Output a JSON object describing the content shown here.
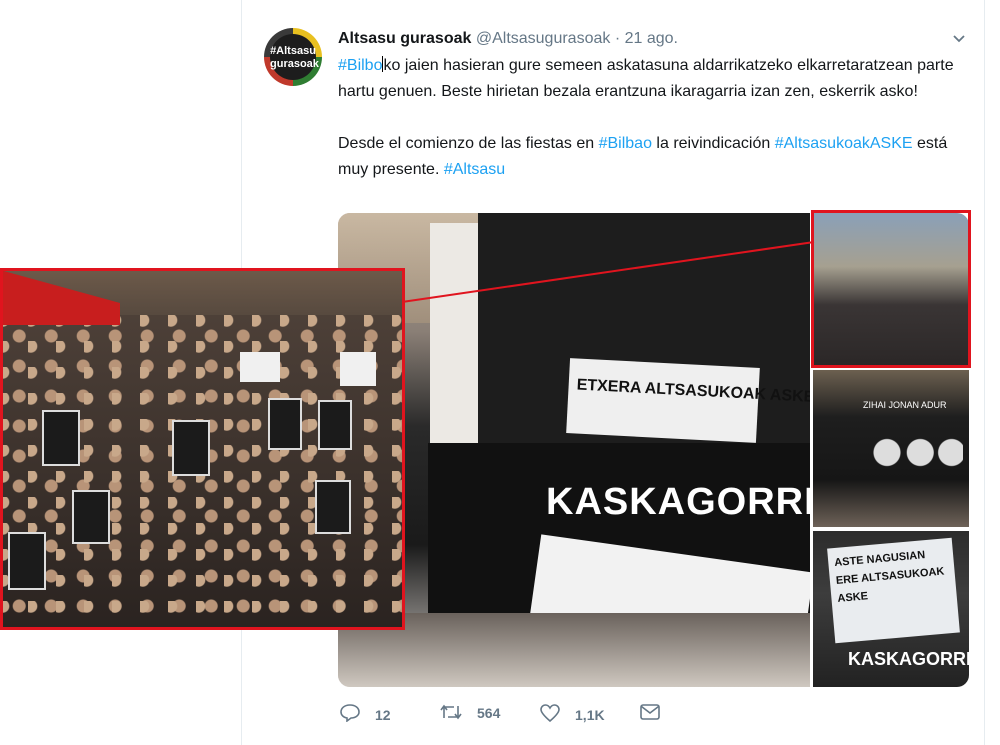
{
  "tweet": {
    "author_name": "Altsasu gurasoak",
    "author_handle": "@Altsasugurasoak",
    "separator": "·",
    "date": "21 ago.",
    "avatar_text": "#Altsasu gurasoak",
    "line1_tag": "#Bilbo",
    "line1_rest": "ko jaien hasieran gure semeen askatasuna aldarrikatzeko elkarretaratzean parte hartu genuen. Beste hirietan bezala erantzuna ikaragarria izan zen, eskerrik asko!",
    "line2_pre": "Desde el comienzo de las fiestas en ",
    "line2_tag1": "#Bilbao",
    "line2_mid": " la reivindicación ",
    "line2_tag2": "#AltsasukoakASKE",
    "line2_post": " está muy presente. ",
    "line2_tag3": "#Altsasu"
  },
  "photos": {
    "main_word": "KASKAGORRI",
    "stage_banner": "ETXERA ALTSASUKOAK ASKE",
    "wall_names": "ZIHAI  JONAN  ADUR",
    "thumb3_banner": "ASTE NAGUSIAN ERE ALTSASUKOAK ASKE",
    "thumb3_word": "KASKAGORRI",
    "side_word": "KASKA GORRI"
  },
  "actions": {
    "replies": "12",
    "retweets": "564",
    "likes": "1,1K"
  },
  "colors": {
    "link": "#1da1f2",
    "highlight_border": "#e0141e",
    "muted": "#657786"
  },
  "icons": {
    "reply": "reply-icon",
    "retweet": "retweet-icon",
    "like": "heart-icon",
    "dm": "envelope-icon",
    "menu": "chevron-down-icon"
  }
}
